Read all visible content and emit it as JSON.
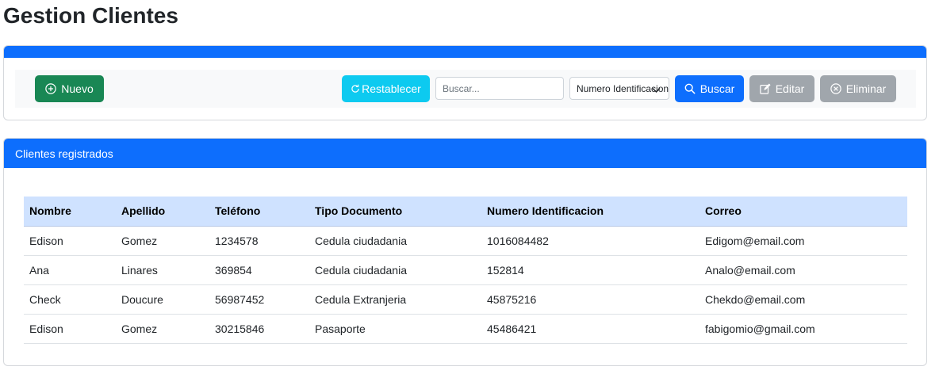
{
  "page": {
    "title": "Gestion Clientes"
  },
  "toolbar": {
    "new_label": "Nuevo",
    "reset_label": "Restablecer",
    "search_placeholder": "Buscar...",
    "search_value": "",
    "filter_selected": "Numero Identificacion",
    "search_label": "Buscar",
    "edit_label": "Editar",
    "delete_label": "Eliminar"
  },
  "clients_card": {
    "header": "Clientes registrados"
  },
  "table": {
    "columns": [
      "Nombre",
      "Apellido",
      "Teléfono",
      "Tipo Documento",
      "Numero Identificacion",
      "Correo"
    ],
    "rows": [
      [
        "Edison",
        "Gomez",
        "1234578",
        "Cedula ciudadania",
        "1016084482",
        "Edigom@email.com"
      ],
      [
        "Ana",
        "Linares",
        "369854",
        "Cedula ciudadania",
        "152814",
        "Analo@email.com"
      ],
      [
        "Check",
        "Doucure",
        "56987452",
        "Cedula Extranjeria",
        "45875216",
        "Chekdo@email.com"
      ],
      [
        "Edison",
        "Gomez",
        "30215846",
        "Pasaporte",
        "45486421",
        "fabigomio@gmail.com"
      ]
    ]
  },
  "colors": {
    "primary": "#0d6efd",
    "success": "#198754",
    "info": "#0dcaf0",
    "disabled": "#a0a6ac",
    "table_header": "#cfe2ff"
  }
}
